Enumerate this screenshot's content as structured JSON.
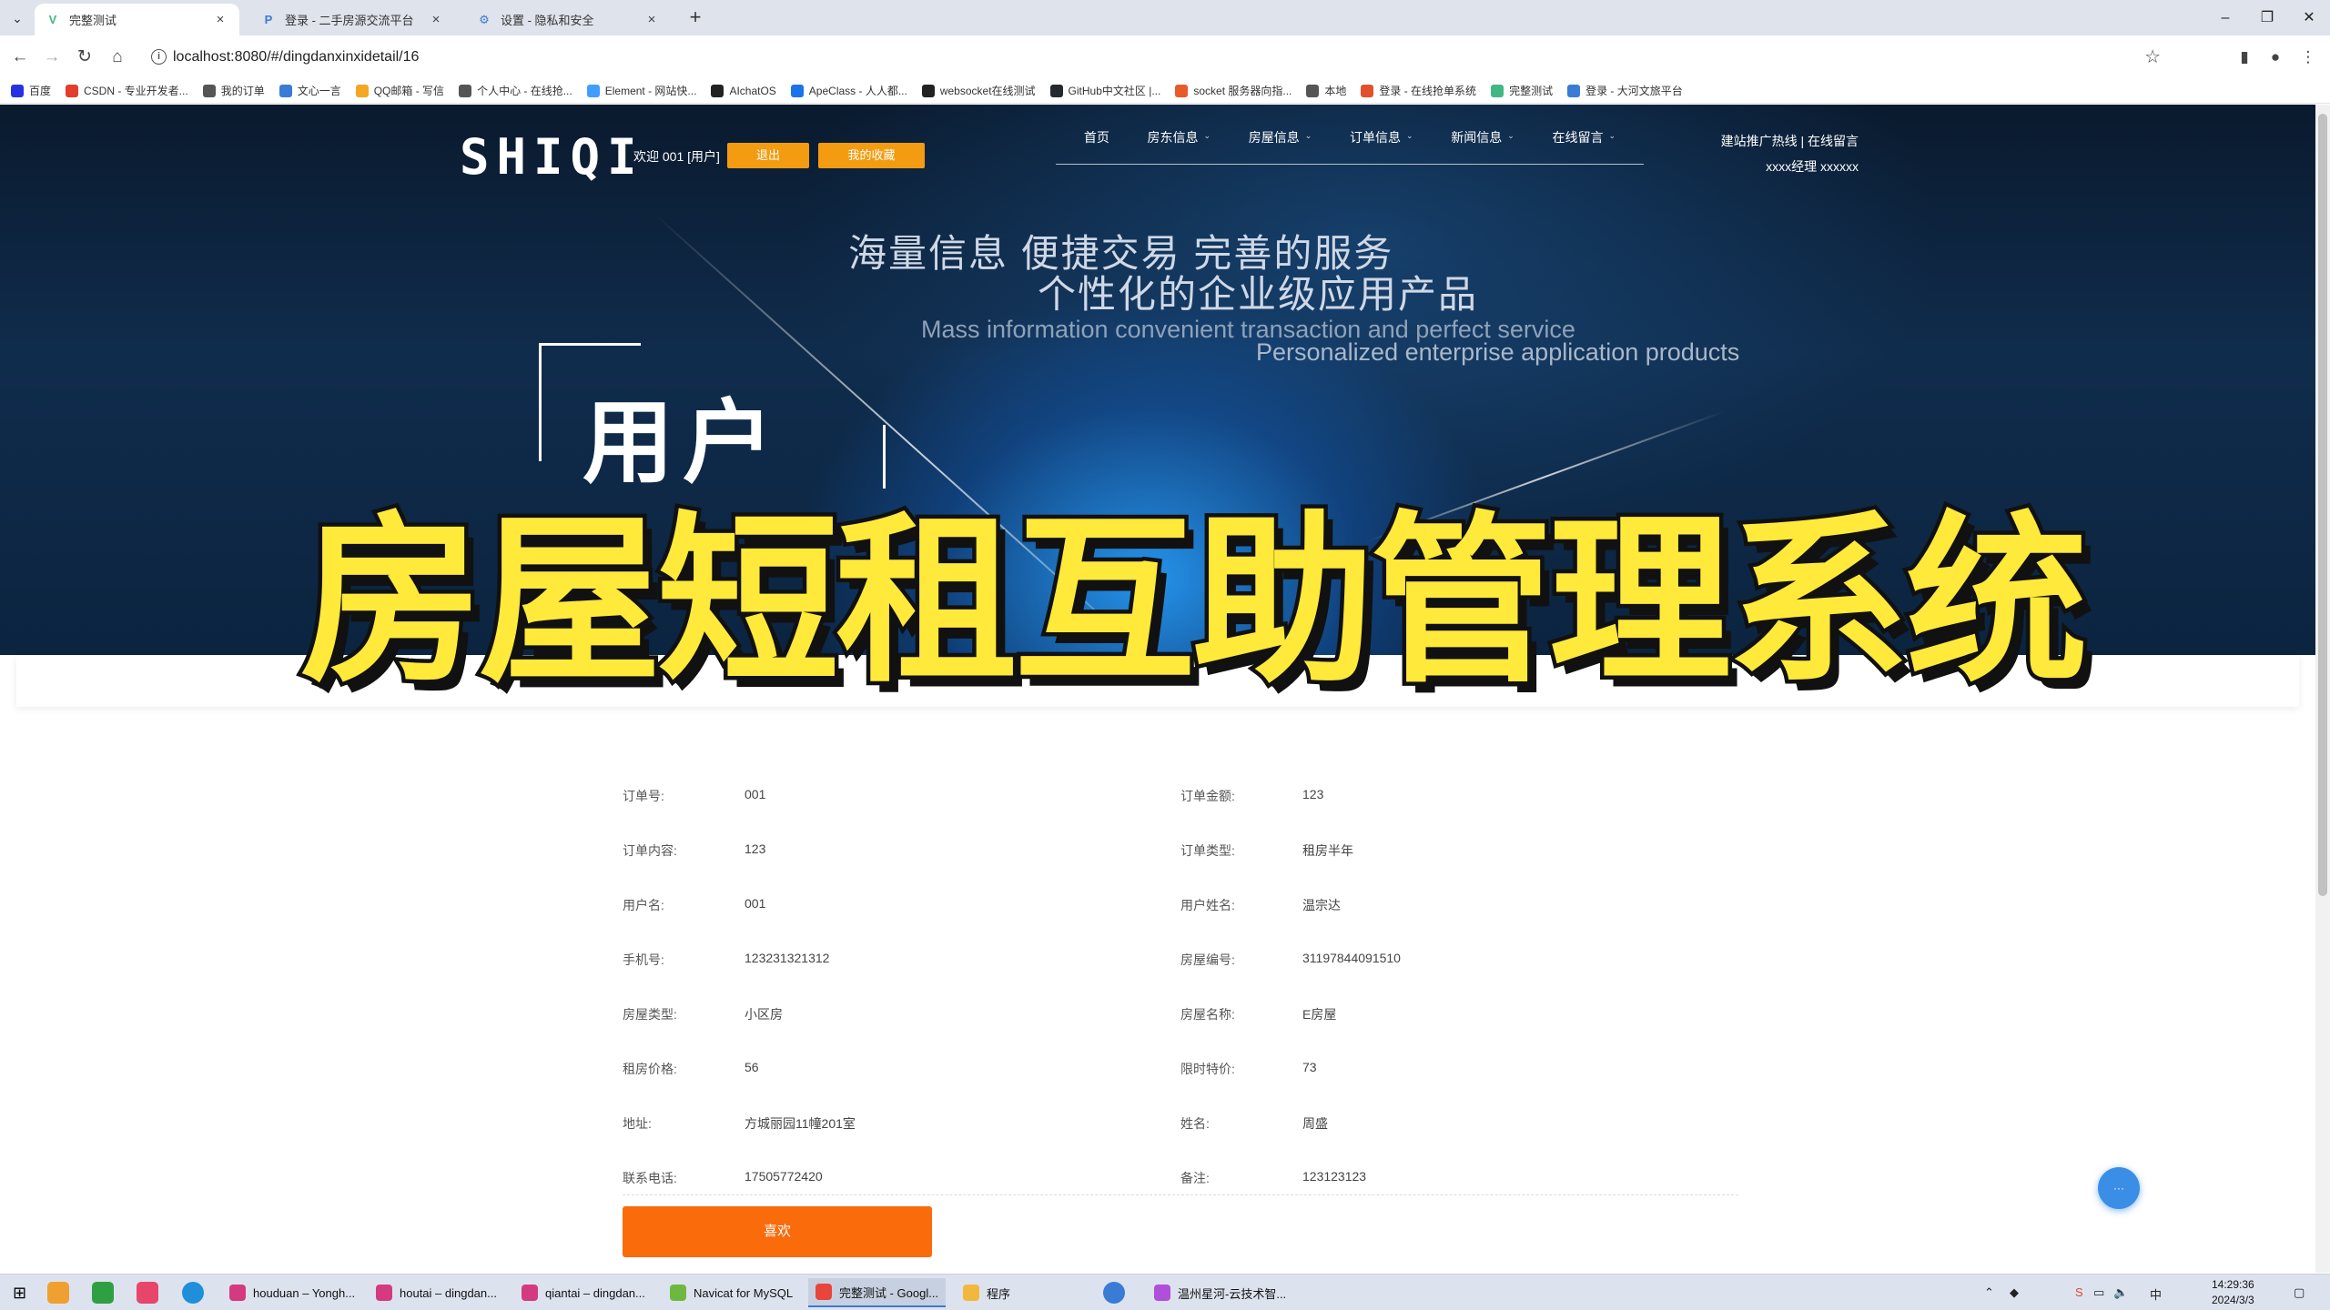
{
  "browser": {
    "tabs": [
      {
        "title": "完整测试",
        "active": true,
        "icon": "vue-icon"
      },
      {
        "title": "登录 - 二手房源交流平台",
        "active": false,
        "icon": "p-icon"
      },
      {
        "title": "设置 - 隐私和安全",
        "active": false,
        "icon": "gear-icon"
      }
    ],
    "url": "localhost:8080/#/dingdanxinxidetail/16",
    "bookmarks": [
      "百度",
      "CSDN - 专业开发者...",
      "我的订单",
      "文心一言",
      "QQ邮箱 - 写信",
      "个人中心 - 在线抢...",
      "Element - 网站快...",
      "AIchatOS",
      "ApeClass - 人人都...",
      "websocket在线测试",
      "GitHub中文社区 |...",
      "socket 服务器向指...",
      "本地",
      "登录 - 在线抢单系统",
      "完整测试",
      "登录 - 大河文旅平台"
    ]
  },
  "header": {
    "logo": "SHIQI",
    "welcome": "欢迎 001 [用户]",
    "logout_label": "退出",
    "favorites_label": "我的收藏",
    "nav": [
      {
        "label": "首页",
        "caret": false
      },
      {
        "label": "房东信息",
        "caret": true
      },
      {
        "label": "房屋信息",
        "caret": true
      },
      {
        "label": "订单信息",
        "caret": true
      },
      {
        "label": "新闻信息",
        "caret": true
      },
      {
        "label": "在线留言",
        "caret": true
      }
    ],
    "hotline_title": "建站推广热线 | 在线留言",
    "hotline_contact": "xxxx经理 xxxxxx"
  },
  "hero": {
    "slogan_line1": "海量信息 便捷交易 完善的服务",
    "slogan_line2": "个性化的企业级应用产品",
    "slogan_en1": "Mass information convenient transaction and perfect service",
    "slogan_en2": "Personalized enterprise application products",
    "big_text": "用户"
  },
  "overlay_title": "房屋短租互助管理系统",
  "order_detail": {
    "rows": [
      [
        {
          "label": "订单号:",
          "value": "001"
        },
        {
          "label": "订单金额:",
          "value": "123"
        }
      ],
      [
        {
          "label": "订单内容:",
          "value": "123"
        },
        {
          "label": "订单类型:",
          "value": "租房半年"
        }
      ],
      [
        {
          "label": "用户名:",
          "value": "001"
        },
        {
          "label": "用户姓名:",
          "value": "温宗达"
        }
      ],
      [
        {
          "label": "手机号:",
          "value": "123231321312"
        },
        {
          "label": "房屋编号:",
          "value": "31197844091510"
        }
      ],
      [
        {
          "label": "房屋类型:",
          "value": "小区房"
        },
        {
          "label": "房屋名称:",
          "value": "E房屋"
        }
      ],
      [
        {
          "label": "租房价格:",
          "value": "56"
        },
        {
          "label": "限时特价:",
          "value": "73"
        }
      ],
      [
        {
          "label": "地址:",
          "value": "方城丽园11幢201室"
        },
        {
          "label": "姓名:",
          "value": "周盛"
        }
      ],
      [
        {
          "label": "联系电话:",
          "value": "17505772420"
        },
        {
          "label": "备注:",
          "value": "123123123"
        }
      ]
    ],
    "like_label": "喜欢"
  },
  "taskbar": {
    "apps": [
      {
        "label": "houduan – Yongh...",
        "color": "#d43a7f",
        "active": false
      },
      {
        "label": "houtai – dingdan...",
        "color": "#d43a7f",
        "active": false
      },
      {
        "label": "qiantai – dingdan...",
        "color": "#d43a7f",
        "active": false
      },
      {
        "label": "Navicat for MySQL",
        "color": "#6fb83f",
        "active": false
      },
      {
        "label": "完整测试 - Googl...",
        "color": "#e8453c",
        "active": true
      },
      {
        "label": "程序",
        "color": "#f2b83d",
        "active": false
      },
      {
        "label": "温州星河-云技术智...",
        "color": "#b04fd9",
        "active": false
      }
    ],
    "ime": "中",
    "time": "14:29:36",
    "date": "2024/3/3"
  }
}
